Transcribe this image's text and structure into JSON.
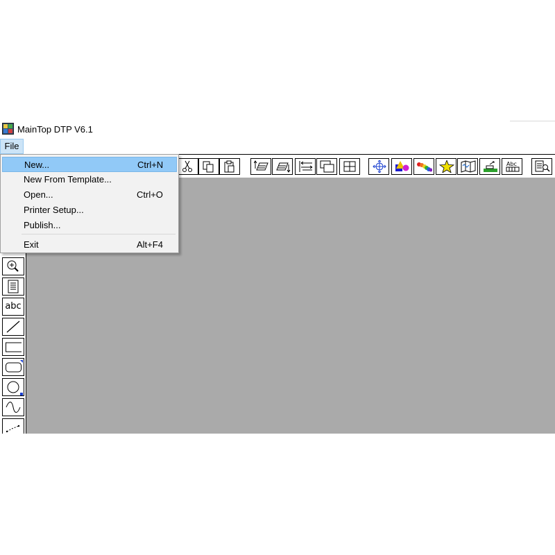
{
  "window": {
    "title": "MainTop DTP V6.1"
  },
  "menubar": {
    "file_label": "File"
  },
  "file_menu": {
    "items": [
      {
        "label": "New...",
        "shortcut": "Ctrl+N",
        "highlighted": true
      },
      {
        "label": "New From Template...",
        "shortcut": ""
      },
      {
        "label": "Open...",
        "shortcut": "Ctrl+O"
      },
      {
        "label": "Printer Setup...",
        "shortcut": ""
      },
      {
        "label": "Publish...",
        "shortcut": ""
      },
      {
        "label": "Exit",
        "shortcut": "Alt+F4"
      }
    ]
  },
  "left_tools": {
    "text_tool_label": "abc"
  },
  "toolbar_icons": [
    "cut-icon",
    "copy-icon",
    "paste-icon",
    "bring-forward-icon",
    "send-backward-icon",
    "align-icon",
    "group-icon",
    "ungroup-icon",
    "move-icon",
    "shapes-color-icon",
    "rainbow-icon",
    "star-icon",
    "map-icon",
    "chart-icon",
    "text-fit-icon",
    "properties-icon"
  ],
  "colors": {
    "canvas": "#aaaaaa",
    "menu_highlight": "#91c9f7",
    "menu_bg": "#f2f2f2"
  }
}
